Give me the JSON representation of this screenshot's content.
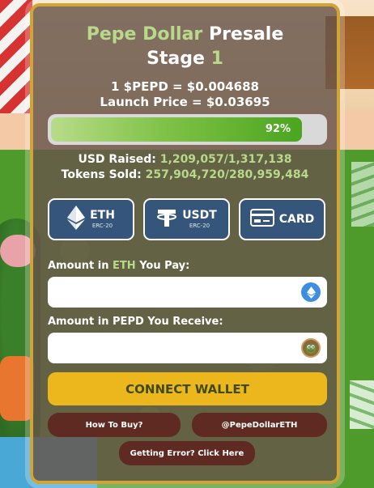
{
  "title": {
    "word1": "Pepe Dollar",
    "word2": "Presale",
    "stage_label": "Stage",
    "stage_number": "1"
  },
  "price": {
    "current": "1 $PEPD = $0.004688",
    "launch": "Launch Price = $0.03695"
  },
  "progress": {
    "percent_text": "92%",
    "fraction": 0.92
  },
  "stats": {
    "usd_raised_label": "USD Raised:",
    "usd_raised_value": "1,209,057/1,317,138",
    "tokens_sold_label": "Tokens Sold:",
    "tokens_sold_value": "257,904,720/280,959,484"
  },
  "payment_methods": [
    {
      "label": "ETH",
      "sub": "ERC-20",
      "icon": "ethereum-icon"
    },
    {
      "label": "USDT",
      "sub": "ERC-20",
      "icon": "tether-icon"
    },
    {
      "label": "CARD",
      "sub": "",
      "icon": "credit-card-icon"
    }
  ],
  "pay_field": {
    "label_pre": "Amount in",
    "label_token": "ETH",
    "label_post": "You Pay:",
    "value": "",
    "icon": "ethereum-icon"
  },
  "receive_field": {
    "label_pre": "Amount in",
    "label_token": "PEPD",
    "label_post": "You Receive:",
    "value": "",
    "icon": "pepe-token-icon"
  },
  "buttons": {
    "connect": "CONNECT WALLET",
    "how_to_buy": "How To Buy?",
    "social": "@PepeDollarETH",
    "error": "Getting Error? Click Here"
  },
  "colors": {
    "accent_green": "#b9d98a",
    "card_border": "#d1a535",
    "connect_yellow": "#ecb61d",
    "pay_button_blue": "#35557a",
    "small_button_brown": "#5e2a22"
  }
}
